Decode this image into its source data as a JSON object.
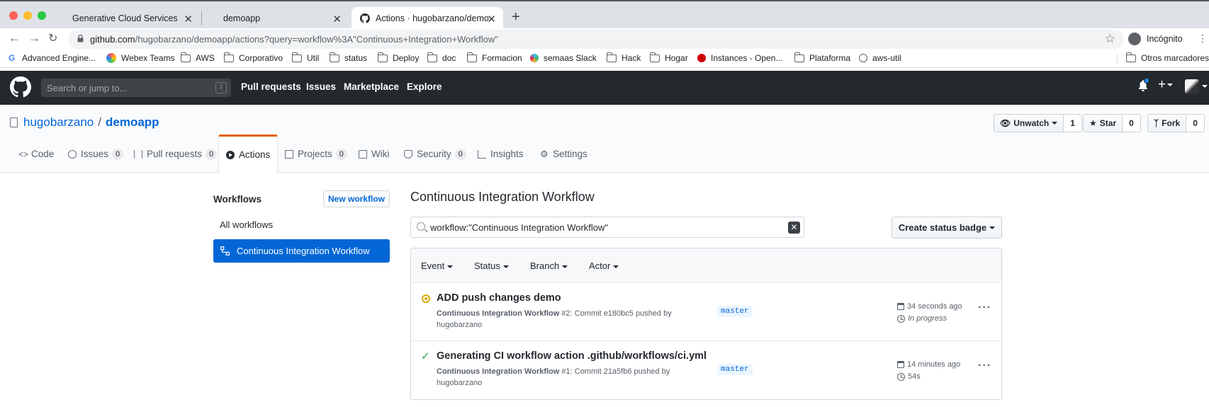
{
  "browser": {
    "tabs": [
      {
        "title": "Generative Cloud Services",
        "close": "✕"
      },
      {
        "title": "demoapp",
        "close": "✕"
      },
      {
        "title": "Actions · hugobarzano/demoapp",
        "close": "✕"
      }
    ],
    "new_tab": "+",
    "url_domain": "github.com",
    "url_path": "/hugobarzano/demoapp/actions?query=workflow%3A\"Continuous+Integration+Workflow\"",
    "profile_label": "Incógnito",
    "bookmarks": [
      {
        "label": "Advanced Engine...",
        "icon": "google-icon"
      },
      {
        "label": "Webex Teams",
        "icon": "webex-icon"
      },
      {
        "label": "AWS",
        "icon": "folder-icon"
      },
      {
        "label": "Corporativo",
        "icon": "folder-icon"
      },
      {
        "label": "Util",
        "icon": "folder-icon"
      },
      {
        "label": "status",
        "icon": "folder-icon"
      },
      {
        "label": "Deploy",
        "icon": "folder-icon"
      },
      {
        "label": "doc",
        "icon": "folder-icon"
      },
      {
        "label": "Formacion",
        "icon": "folder-icon"
      },
      {
        "label": "semaas Slack",
        "icon": "slack-icon"
      },
      {
        "label": "Hack",
        "icon": "folder-icon"
      },
      {
        "label": "Hogar",
        "icon": "folder-icon"
      },
      {
        "label": "Instances - Open...",
        "icon": "openshift-icon"
      },
      {
        "label": "Plataforma",
        "icon": "folder-icon"
      },
      {
        "label": "aws-util",
        "icon": "globe-icon"
      },
      {
        "label": "Otros marcadores",
        "icon": "folder-icon"
      }
    ]
  },
  "github": {
    "search_placeholder": "Search or jump to...",
    "search_shortcut": "/",
    "nav": [
      "Pull requests",
      "Issues",
      "Marketplace",
      "Explore"
    ]
  },
  "repo": {
    "owner": "hugobarzano",
    "separator": "/",
    "name": "demoapp",
    "watch_label": "Unwatch",
    "watch_count": "1",
    "star_label": "Star",
    "star_count": "0",
    "fork_label": "Fork",
    "fork_count": "0",
    "tabs": [
      {
        "label": "Code",
        "counter": null
      },
      {
        "label": "Issues",
        "counter": "0"
      },
      {
        "label": "Pull requests",
        "counter": "0"
      },
      {
        "label": "Actions",
        "counter": null
      },
      {
        "label": "Projects",
        "counter": "0"
      },
      {
        "label": "Wiki",
        "counter": null
      },
      {
        "label": "Security",
        "counter": "0"
      },
      {
        "label": "Insights",
        "counter": null
      },
      {
        "label": "Settings",
        "counter": null
      }
    ]
  },
  "sidebar": {
    "title": "Workflows",
    "new_workflow": "New workflow",
    "all_workflows": "All workflows",
    "selected_workflow": "Continuous Integration Workflow"
  },
  "main": {
    "title": "Continuous Integration Workflow",
    "filter_value": "workflow:\"Continuous Integration Workflow\"",
    "create_badge": "Create status badge",
    "filters": [
      "Event",
      "Status",
      "Branch",
      "Actor"
    ],
    "runs": [
      {
        "status": "in_progress",
        "title": "ADD push changes demo",
        "workflow": "Continuous Integration Workflow",
        "meta": " #2: Commit e180bc5 pushed by hugobarzano",
        "branch": "master",
        "when": "34 seconds ago",
        "duration": "In progress"
      },
      {
        "status": "success",
        "title": "Generating CI workflow action .github/workflows/ci.yml",
        "workflow": "Continuous Integration Workflow",
        "meta": " #1: Commit 21a5fb6 pushed by hugobarzano",
        "branch": "master",
        "when": "14 minutes ago",
        "duration": "54s"
      }
    ]
  },
  "colors": {
    "gh_header": "#24292e",
    "link_blue": "#0366d6",
    "selected_tab_accent": "#e36209",
    "in_progress": "#dbab09",
    "success": "#28a745"
  }
}
